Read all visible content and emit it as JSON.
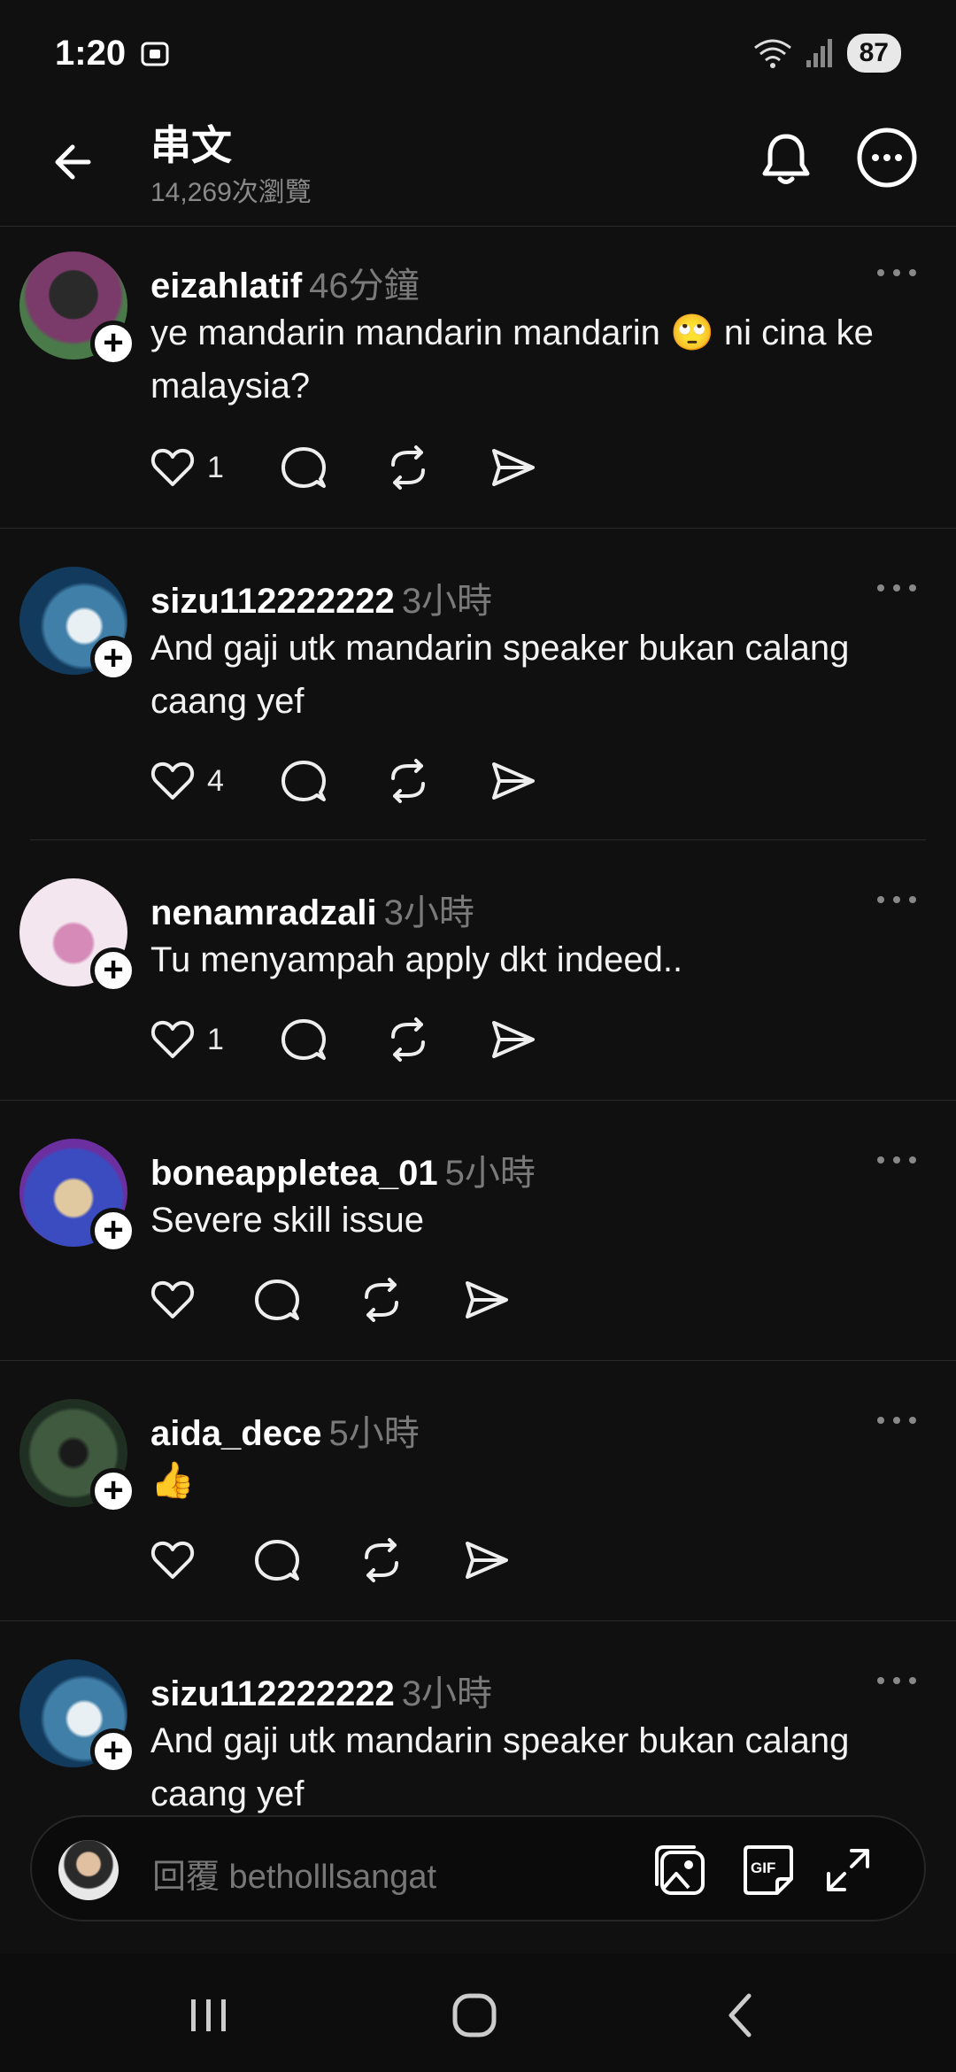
{
  "status": {
    "time": "1:20",
    "battery": "87"
  },
  "header": {
    "title": "串文",
    "views": "14,269次瀏覽"
  },
  "posts": [
    {
      "username": "eizahlatif",
      "time": "46分鐘",
      "text": "ye mandarin mandarin mandarin 🙄 ni cina ke malaysia?",
      "likes": "1"
    },
    {
      "username": "sizu112222222",
      "time": "3小時",
      "text": "And gaji utk mandarin speaker bukan calang caang yef",
      "likes": "4"
    },
    {
      "username": "nenamradzali",
      "time": "3小時",
      "text": "Tu menyampah apply dkt indeed..",
      "likes": "1"
    },
    {
      "username": "boneappletea_01",
      "time": "5小時",
      "text": "Severe skill issue",
      "likes": ""
    },
    {
      "username": "aida_dece",
      "time": "5小時",
      "text": "👍",
      "likes": ""
    },
    {
      "username": "sizu112222222",
      "time": "3小時",
      "text": "And gaji utk mandarin speaker bukan calang caang yef",
      "likes": ""
    }
  ],
  "reply": {
    "placeholder": "回覆 betholllsangat"
  },
  "colors": {
    "background": "#101010",
    "text": "#f3f3f3",
    "muted": "#7a7a7a",
    "divider": "#2a2a2a"
  }
}
